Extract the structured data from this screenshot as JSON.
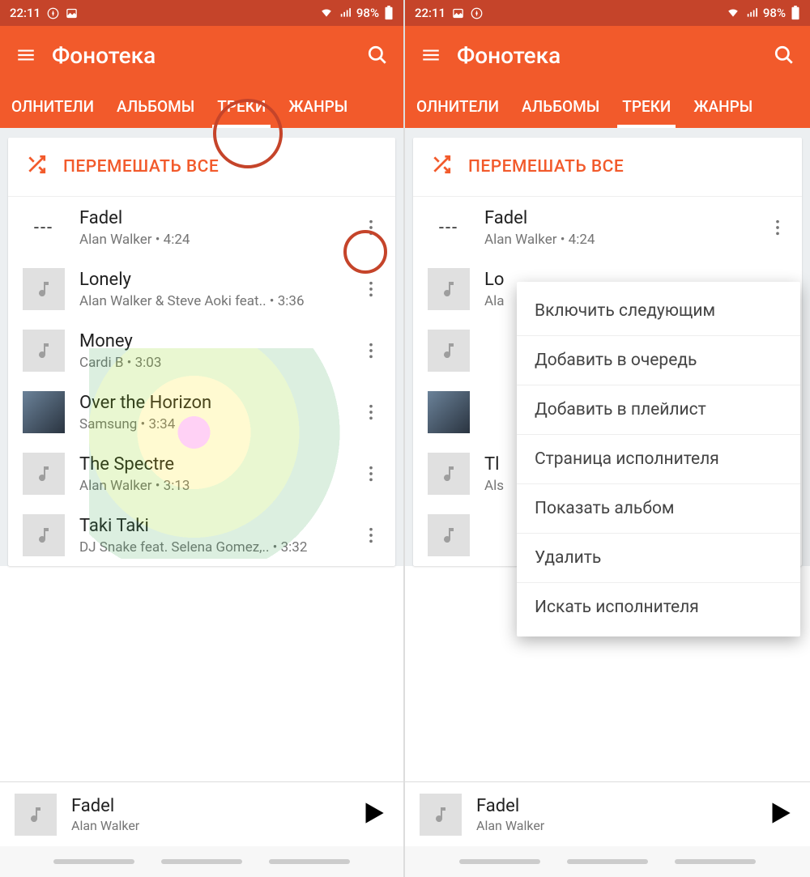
{
  "status": {
    "time": "22:11",
    "battery": "98%"
  },
  "header": {
    "title": "Фонотека"
  },
  "tabs": [
    {
      "label": "ОЛНИТЕЛИ",
      "selected": false
    },
    {
      "label": "АЛЬБОМЫ",
      "selected": false
    },
    {
      "label": "ТРЕКИ",
      "selected": true
    },
    {
      "label": "ЖАНРЫ",
      "selected": false
    }
  ],
  "shuffle_label": "ПЕРЕМЕШАТЬ ВСЕ",
  "tracks": [
    {
      "title": "Fadel",
      "sub": "Alan Walker • 4:24",
      "art": "dashes"
    },
    {
      "title": "Lonely",
      "sub": "Alan Walker & Steve Aoki feat.. • 3:36",
      "art": "note"
    },
    {
      "title": "Money",
      "sub": "Cardi B • 3:03",
      "art": "note"
    },
    {
      "title": "Over the Horizon",
      "sub": "Samsung • 3:34",
      "art": "photo"
    },
    {
      "title": "The Spectre",
      "sub": "Alan Walker • 3:13",
      "art": "note"
    },
    {
      "title": "Taki Taki",
      "sub": "DJ Snake feat. Selena Gomez,.. • 3:32",
      "art": "note"
    }
  ],
  "tracks_truncated": [
    {
      "title": "Lo",
      "sub": "Ala"
    },
    {
      "title": "Tl",
      "sub": "Als"
    }
  ],
  "now_playing": {
    "title": "Fadel",
    "artist": "Alan Walker"
  },
  "menu_items": [
    "Включить следующим",
    "Добавить в очередь",
    "Добавить в плейлист",
    "Страница исполнителя",
    "Показать альбом",
    "Удалить",
    "Искать исполнителя"
  ],
  "colors": {
    "accent": "#f25a2b",
    "annotation": "#c5442a"
  }
}
